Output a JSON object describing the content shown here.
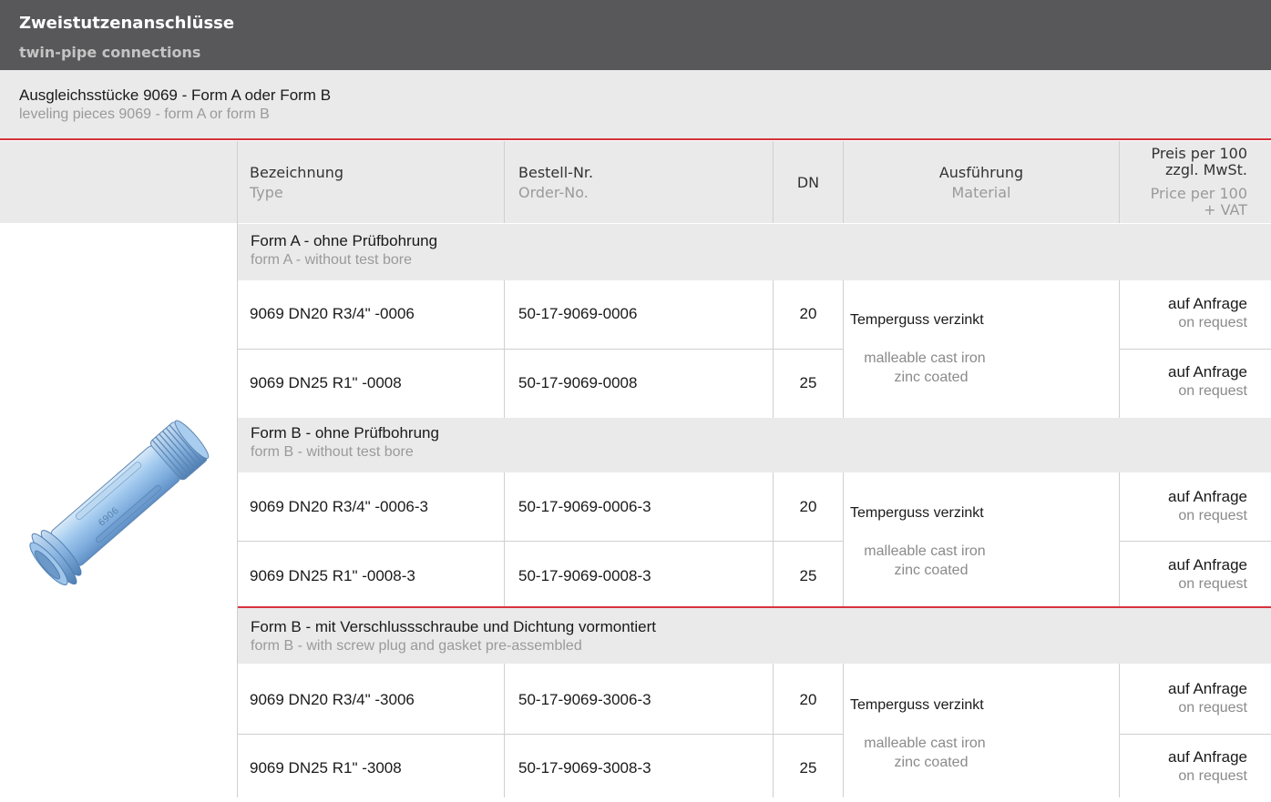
{
  "header": {
    "title_de": "Zweistutzenanschlüsse",
    "title_en": "twin-pipe connections"
  },
  "subheader": {
    "title_de": "Ausgleichsstücke 9069 - Form A oder Form B",
    "title_en": "leveling pieces 9069 - form A or form B"
  },
  "columns": {
    "type_de": "Bezeichnung",
    "type_en": "Type",
    "order_de": "Bestell-Nr.",
    "order_en": "Order-No.",
    "dn": "DN",
    "material_de": "Ausführung",
    "material_en": "Material",
    "price_de_1": "Preis per 100",
    "price_de_2": "zzgl. MwSt.",
    "price_en_1": "Price per 100",
    "price_en_2": "+ VAT"
  },
  "groups": [
    {
      "title_de": "Form A - ohne Prüfbohrung",
      "title_en": "form A - without test bore",
      "material_de": "Temperguss verzinkt",
      "material_en_1": "malleable cast iron",
      "material_en_2": "zinc coated",
      "rows": [
        {
          "type": "9069 DN20 R3/4\" -0006",
          "order": "50-17-9069-0006",
          "dn": "20",
          "price_de": "auf Anfrage",
          "price_en": "on request"
        },
        {
          "type": "9069 DN25 R1\" -0008",
          "order": "50-17-9069-0008",
          "dn": "25",
          "price_de": "auf Anfrage",
          "price_en": "on request"
        }
      ]
    },
    {
      "title_de": "Form B - ohne Prüfbohrung",
      "title_en": "form B - without test bore",
      "material_de": "Temperguss verzinkt",
      "material_en_1": "malleable cast iron",
      "material_en_2": "zinc coated",
      "rows": [
        {
          "type": "9069 DN20 R3/4\" -0006-3",
          "order": "50-17-9069-0006-3",
          "dn": "20",
          "price_de": "auf Anfrage",
          "price_en": "on request"
        },
        {
          "type": "9069 DN25 R1\" -0008-3",
          "order": "50-17-9069-0008-3",
          "dn": "25",
          "price_de": "auf Anfrage",
          "price_en": "on request"
        }
      ]
    },
    {
      "title_de": "Form B - mit Verschlussschraube und Dichtung vormontiert",
      "title_en": "form B - with screw plug and gasket pre-assembled",
      "material_de": "Temperguss verzinkt",
      "material_en_1": "malleable cast iron",
      "material_en_2": "zinc coated",
      "rows": [
        {
          "type": "9069 DN20 R3/4\" -3006",
          "order": "50-17-9069-3006-3",
          "dn": "20",
          "price_de": "auf Anfrage",
          "price_en": "on request"
        },
        {
          "type": "9069 DN25 R1\" -3008",
          "order": "50-17-9069-3008-3",
          "dn": "25",
          "price_de": "auf Anfrage",
          "price_en": "on request"
        }
      ]
    }
  ],
  "product_image": {
    "engraving": "9069"
  },
  "colors": {
    "header_bg": "#58585a",
    "band_bg": "#eaeaea",
    "accent_red": "#d6333d",
    "part_blue": "#8fb9e3"
  }
}
